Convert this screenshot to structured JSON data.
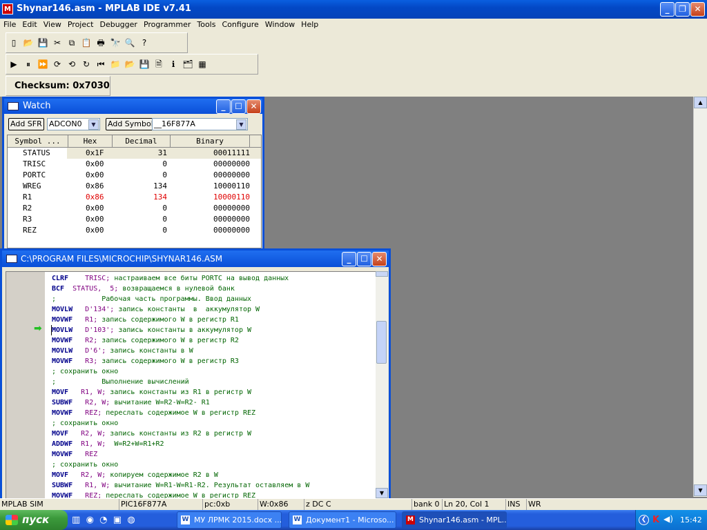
{
  "window": {
    "title": "Shynar146.asm - MPLAB IDE v7.41",
    "app_icon": "MPLAB"
  },
  "menu": [
    "File",
    "Edit",
    "View",
    "Project",
    "Debugger",
    "Programmer",
    "Tools",
    "Configure",
    "Window",
    "Help"
  ],
  "toolbar": {
    "row1": [
      "new-file-icon",
      "open-icon",
      "save-icon",
      "cut-icon",
      "copy-icon",
      "paste-icon",
      "print-icon",
      "find-icon",
      "find-in-files-icon",
      "help-icon"
    ],
    "row1_glyphs": [
      "▯",
      "📂",
      "💾",
      "✂",
      "⧉",
      "📋",
      "🖶",
      "🔭",
      "🔍",
      "?"
    ],
    "row2": [
      "run-icon",
      "halt-icon",
      "animate-icon",
      "step-into-icon",
      "step-over-icon",
      "step-out-icon",
      "reset-icon",
      "new-project-icon",
      "open-project-icon",
      "save-project-icon",
      "build-icon",
      "info-icon",
      "workspace-icon",
      "make-icon"
    ],
    "row2_glyphs": [
      "▶",
      "⏸",
      "⏩",
      "⟳",
      "⟲",
      "↻",
      "⏮",
      "📁",
      "📂",
      "💾",
      "🗎",
      "ℹ",
      "🗂",
      "▦"
    ],
    "checksum": "Checksum:  0x7030"
  },
  "watch": {
    "title": "Watch",
    "add_sfr": "Add SFR",
    "sfr_select": "ADCON0",
    "add_symbol": "Add Symbol",
    "symbol_select": "__16F877A",
    "columns": [
      "Symbol ...",
      "Hex",
      "Decimal",
      "Binary"
    ],
    "rows": [
      {
        "symbol": "STATUS",
        "hex": "0x1F",
        "dec": "31",
        "bin": "00011111",
        "changed": false
      },
      {
        "symbol": "TRISC",
        "hex": "0x00",
        "dec": "0",
        "bin": "00000000",
        "changed": false
      },
      {
        "symbol": "PORTC",
        "hex": "0x00",
        "dec": "0",
        "bin": "00000000",
        "changed": false
      },
      {
        "symbol": "WREG",
        "hex": "0x86",
        "dec": "134",
        "bin": "10000110",
        "changed": false
      },
      {
        "symbol": "R1",
        "hex": "0x86",
        "dec": "134",
        "bin": "10000110",
        "changed": true
      },
      {
        "symbol": "R2",
        "hex": "0x00",
        "dec": "0",
        "bin": "00000000",
        "changed": false
      },
      {
        "symbol": "R3",
        "hex": "0x00",
        "dec": "0",
        "bin": "00000000",
        "changed": false
      },
      {
        "symbol": "REZ",
        "hex": "0x00",
        "dec": "0",
        "bin": "00000000",
        "changed": false
      }
    ]
  },
  "editor": {
    "title": "C:\\PROGRAM FILES\\MICROCHIP\\SHYNAR146.ASM",
    "current_line_index": 5,
    "lines": [
      {
        "k": "CLRF",
        "o": "    TRISC;",
        "c": " настраиваем все биты PORTC на вывод данных"
      },
      {
        "k": "BCF",
        "o": "  STATUS,  5;",
        "c": " возвращаемся в нулевой банк"
      },
      {
        "k": "",
        "o": "",
        "c": ";           Рабочая часть программы. Ввод данных"
      },
      {
        "k": "MOVLW",
        "o": "   D'134';",
        "c": " запись константы  в  аккумулятор W"
      },
      {
        "k": "MOVWF",
        "o": "   R1;",
        "c": " запись содержимого W в регистр R1"
      },
      {
        "k": "MOVLW",
        "o": "   D'103';",
        "c": " запись константы в аккумулятор W"
      },
      {
        "k": "MOVWF",
        "o": "   R2;",
        "c": " запись содержимого W в регистр R2"
      },
      {
        "k": "MOVLW",
        "o": "   D'6';",
        "c": " запись константы в W"
      },
      {
        "k": "MOVWF",
        "o": "   R3;",
        "c": " запись содержимого W в регистр R3"
      },
      {
        "k": "",
        "o": "",
        "c": "; сохранить окно"
      },
      {
        "k": "",
        "o": "",
        "c": ";           Выполнение вычислений"
      },
      {
        "k": "MOVF",
        "o": "   R1, W;",
        "c": " запись константы из R1 в регистр W"
      },
      {
        "k": "SUBWF",
        "o": "   R2, W;",
        "c": " вычитание W=R2-W=R2- R1"
      },
      {
        "k": "MOVWF",
        "o": "   REZ;",
        "c": " переслать содержимое W в регистр REZ"
      },
      {
        "k": "",
        "o": "",
        "c": "; сохранить окно"
      },
      {
        "k": "MOVF",
        "o": "   R2, W;",
        "c": " запись константы из R2 в регистр W"
      },
      {
        "k": "ADDWF",
        "o": "  R1, W;",
        "c": "  W=R2+W=R1+R2"
      },
      {
        "k": "MOVWF",
        "o": "   REZ",
        "c": ""
      },
      {
        "k": "",
        "o": "",
        "c": "; сохранить окно"
      },
      {
        "k": "MOVF",
        "o": "   R2, W;",
        "c": " копируем содержимое R2 в W"
      },
      {
        "k": "SUBWF",
        "o": "   R1, W;",
        "c": " вычитание W=R1-W=R1-R2. Результат оставляем в W"
      },
      {
        "k": "MOVWF",
        "o": "   REZ;",
        "c": " переслать содержимое W в регистр REZ"
      }
    ]
  },
  "statusbar": [
    "MPLAB SIM",
    "PIC16F877A",
    "pc:0xb",
    "W:0x86",
    "z DC C",
    "bank 0",
    "Ln 20, Col 1",
    "INS",
    "WR"
  ],
  "taskbar": {
    "start": "пуск",
    "tasks": [
      "МУ ЛРМК 2015.docx ...",
      "Документ1 - Microso...",
      "Shynar146.asm - MPL..."
    ],
    "clock": "15:42"
  },
  "colors": {
    "titlebar": "#0a5fe0",
    "changed_value": "#e00000",
    "keyword": "#00008b",
    "operand": "#800080",
    "comment": "#006400",
    "arrow": "#22c022"
  }
}
